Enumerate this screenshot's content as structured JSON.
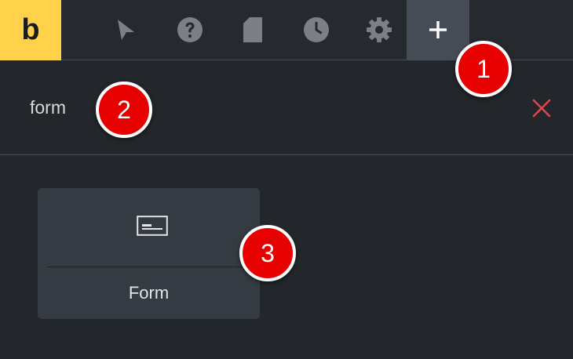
{
  "app": {
    "logo_letter": "b",
    "brand_color": "#ffd24a"
  },
  "toolbar": {
    "tools": [
      {
        "name": "cursor-icon",
        "active": false
      },
      {
        "name": "help-icon",
        "active": false
      },
      {
        "name": "document-icon",
        "active": false
      },
      {
        "name": "history-icon",
        "active": false
      },
      {
        "name": "settings-icon",
        "active": false
      },
      {
        "name": "plus-icon",
        "active": true
      }
    ]
  },
  "search": {
    "value": "form",
    "clear_icon": "close-icon",
    "clear_color": "#e0454a"
  },
  "results": {
    "modules": [
      {
        "label": "Form",
        "icon": "form-icon"
      }
    ]
  },
  "markers": [
    "1",
    "2",
    "3"
  ]
}
